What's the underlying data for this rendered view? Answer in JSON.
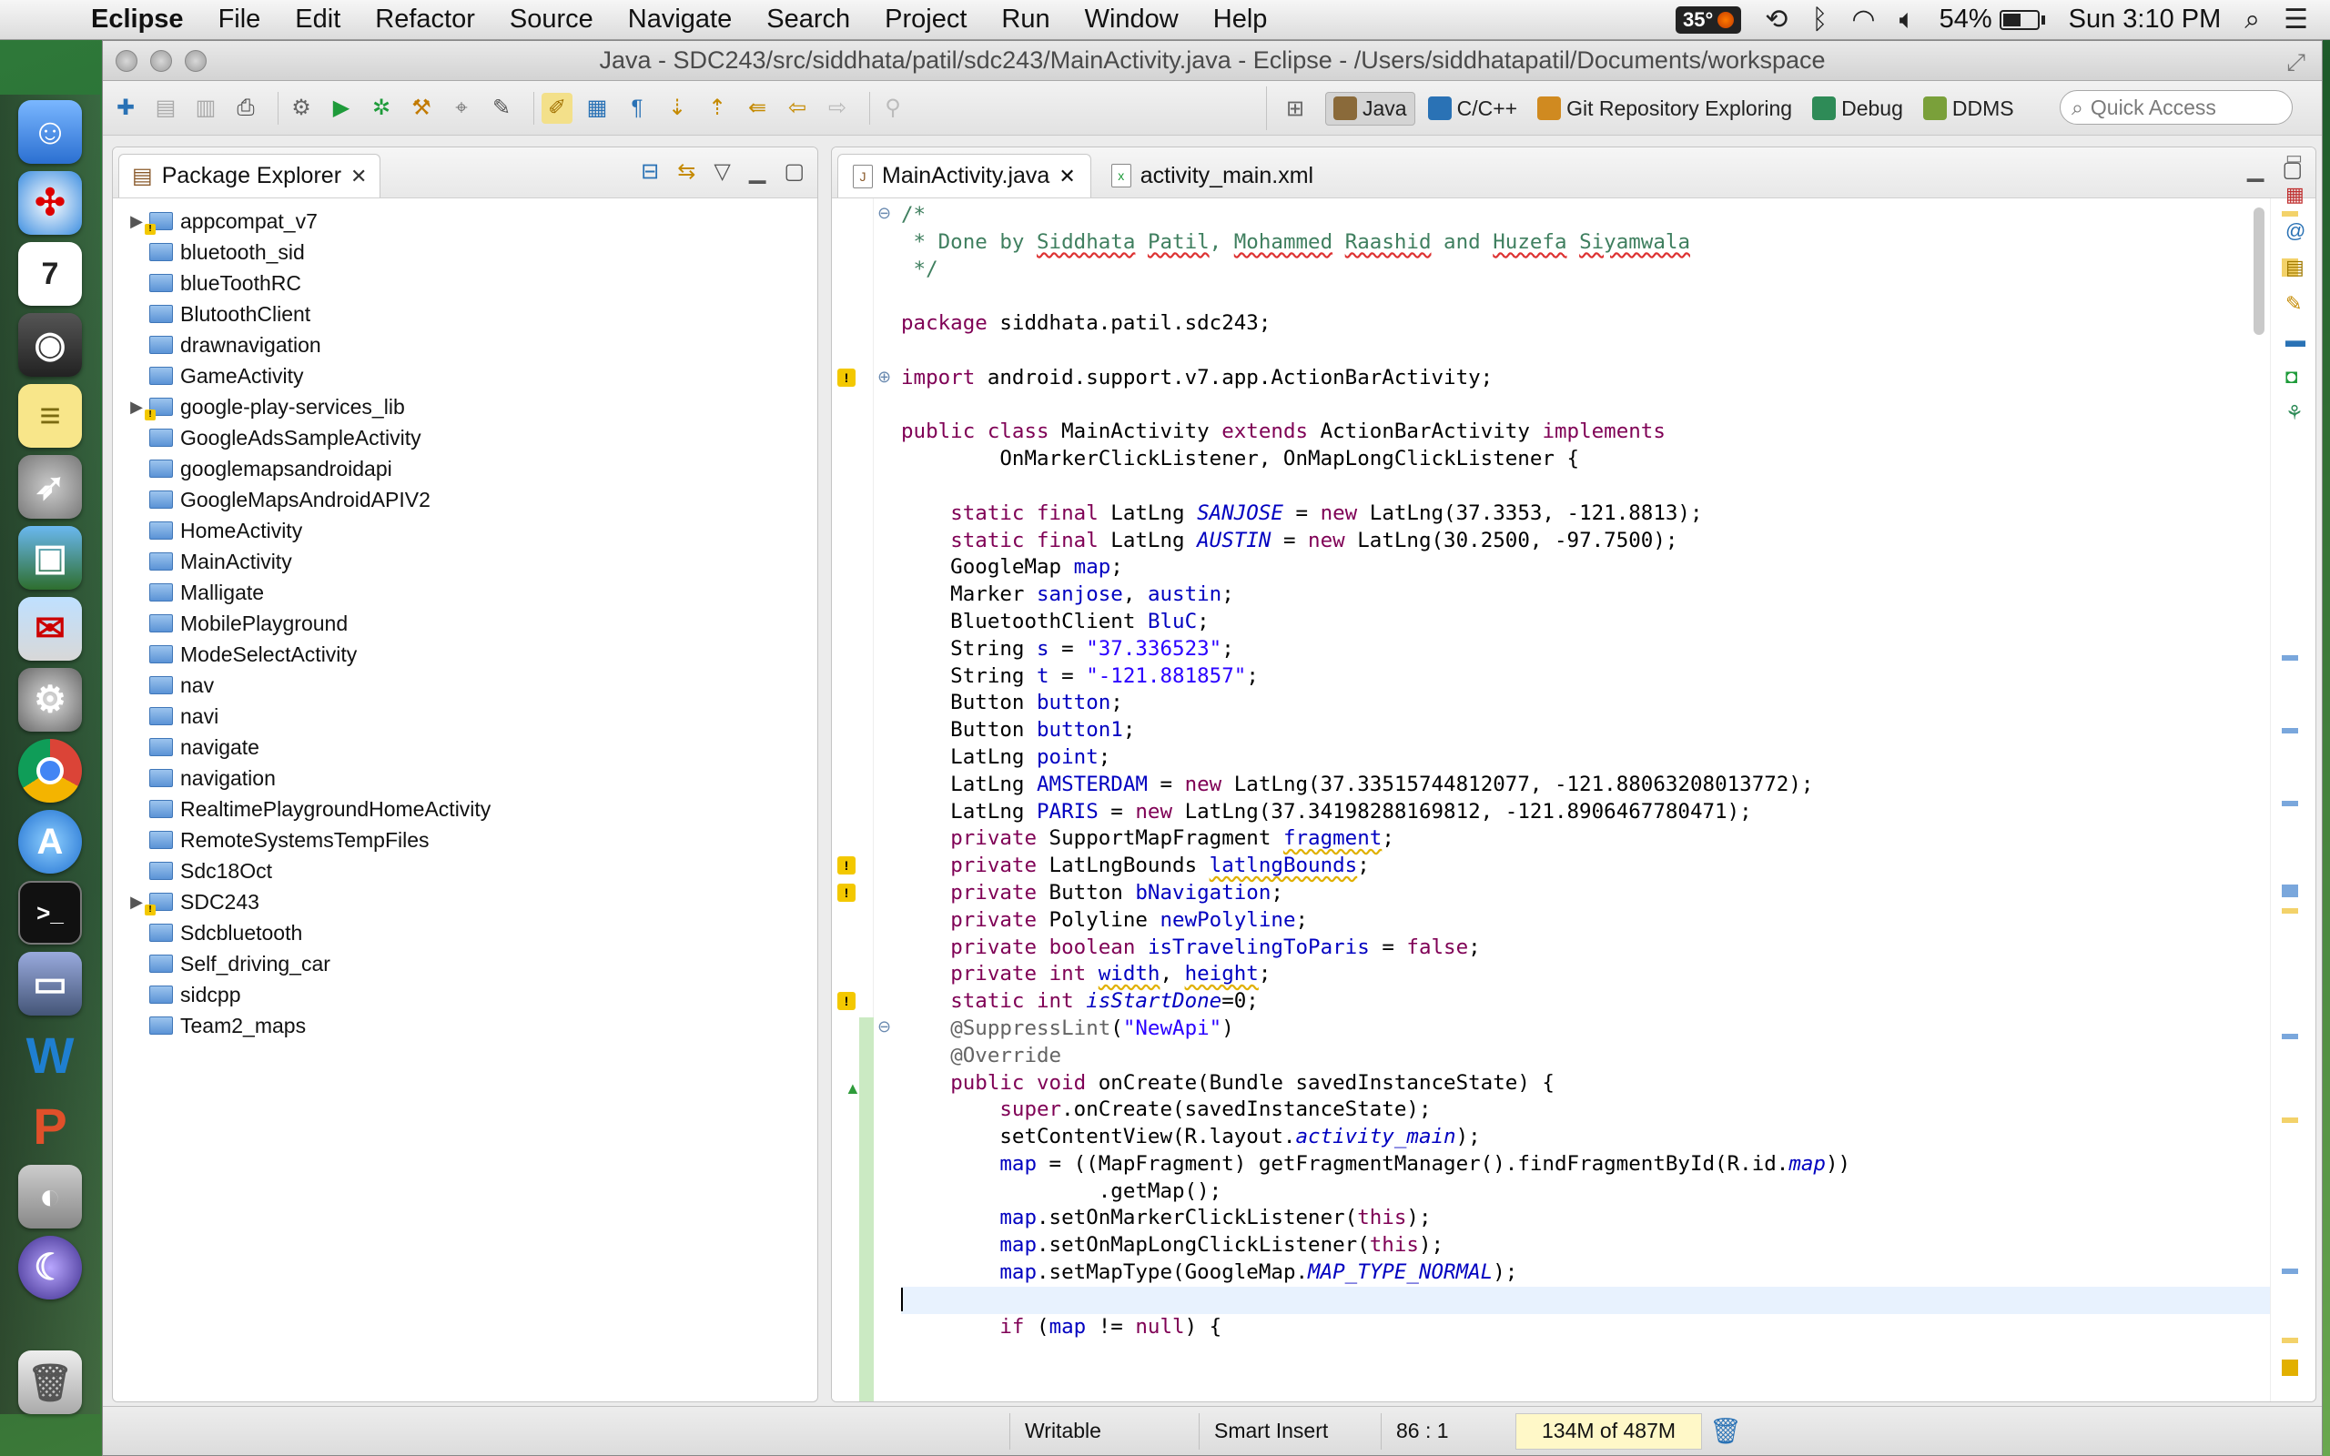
{
  "menubar": {
    "app_name": "Eclipse",
    "menus": [
      "File",
      "Edit",
      "Refactor",
      "Source",
      "Navigate",
      "Search",
      "Project",
      "Run",
      "Window",
      "Help"
    ],
    "temperature": "35°",
    "battery_percent": "54%",
    "battery_level": 0.54,
    "clock": "Sun 3:10 PM"
  },
  "window": {
    "title": "Java - SDC243/src/siddhata/patil/sdc243/MainActivity.java - Eclipse - /Users/siddhatapatil/Documents/workspace"
  },
  "perspectives": [
    {
      "label": "Java",
      "icon": "java-perspective-icon",
      "active": true
    },
    {
      "label": "C/C++",
      "icon": "cpp-perspective-icon",
      "active": false
    },
    {
      "label": "Git Repository Exploring",
      "icon": "git-perspective-icon",
      "active": false
    },
    {
      "label": "Debug",
      "icon": "debug-perspective-icon",
      "active": false
    },
    {
      "label": "DDMS",
      "icon": "ddms-perspective-icon",
      "active": false
    }
  ],
  "quick_access": {
    "placeholder": "Quick Access"
  },
  "package_explorer": {
    "title": "Package Explorer",
    "projects": [
      {
        "name": "appcompat_v7",
        "expandable": true,
        "warning": true
      },
      {
        "name": "bluetooth_sid",
        "expandable": false,
        "warning": false
      },
      {
        "name": "blueToothRC",
        "expandable": false,
        "warning": false
      },
      {
        "name": "BlutoothClient",
        "expandable": false,
        "warning": false
      },
      {
        "name": "drawnavigation",
        "expandable": false,
        "warning": false
      },
      {
        "name": "GameActivity",
        "expandable": false,
        "warning": false
      },
      {
        "name": "google-play-services_lib",
        "expandable": true,
        "warning": true
      },
      {
        "name": "GoogleAdsSampleActivity",
        "expandable": false,
        "warning": false
      },
      {
        "name": "googlemapsandroidapi",
        "expandable": false,
        "warning": false
      },
      {
        "name": "GoogleMapsAndroidAPIV2",
        "expandable": false,
        "warning": false
      },
      {
        "name": "HomeActivity",
        "expandable": false,
        "warning": false
      },
      {
        "name": "MainActivity",
        "expandable": false,
        "warning": false
      },
      {
        "name": "Malligate",
        "expandable": false,
        "warning": false
      },
      {
        "name": "MobilePlayground",
        "expandable": false,
        "warning": false
      },
      {
        "name": "ModeSelectActivity",
        "expandable": false,
        "warning": false
      },
      {
        "name": "nav",
        "expandable": false,
        "warning": false
      },
      {
        "name": "navi",
        "expandable": false,
        "warning": false
      },
      {
        "name": "navigate",
        "expandable": false,
        "warning": false
      },
      {
        "name": "navigation",
        "expandable": false,
        "warning": false
      },
      {
        "name": "RealtimePlaygroundHomeActivity",
        "expandable": false,
        "warning": false
      },
      {
        "name": "RemoteSystemsTempFiles",
        "expandable": false,
        "warning": false
      },
      {
        "name": "Sdc18Oct",
        "expandable": false,
        "warning": false
      },
      {
        "name": "SDC243",
        "expandable": true,
        "warning": true
      },
      {
        "name": "Sdcbluetooth",
        "expandable": false,
        "warning": false
      },
      {
        "name": "Self_driving_car",
        "expandable": false,
        "warning": false
      },
      {
        "name": "sidcpp",
        "expandable": false,
        "warning": false
      },
      {
        "name": "Team2_maps",
        "expandable": false,
        "warning": false
      }
    ]
  },
  "editor": {
    "tabs": [
      {
        "label": "MainActivity.java",
        "active": true,
        "icon": "java-file-icon"
      },
      {
        "label": "activity_main.xml",
        "active": false,
        "icon": "xml-file-icon"
      }
    ],
    "current_line": 40,
    "warning_lines": [
      6,
      24,
      25,
      29
    ],
    "code_lines": [
      [
        [
          "cm",
          "/*"
        ]
      ],
      [
        [
          "cm",
          " * Done by "
        ],
        [
          "cm spell",
          "Siddhata"
        ],
        [
          "cm",
          " "
        ],
        [
          "cm spell",
          "Patil"
        ],
        [
          "cm",
          ", "
        ],
        [
          "cm spell",
          "Mohammed"
        ],
        [
          "cm",
          " "
        ],
        [
          "cm spell",
          "Raashid"
        ],
        [
          "cm",
          " and "
        ],
        [
          "cm spell",
          "Huzefa"
        ],
        [
          "cm",
          " "
        ],
        [
          "cm spell",
          "Siyamwala"
        ]
      ],
      [
        [
          "cm",
          " */"
        ]
      ],
      [],
      [
        [
          "kw",
          "package"
        ],
        [
          "",
          " siddhata.patil.sdc243;"
        ]
      ],
      [],
      [
        [
          "kw",
          "import"
        ],
        [
          "",
          " android.support.v7.app.ActionBarActivity;"
        ]
      ],
      [],
      [
        [
          "kw",
          "public"
        ],
        [
          "",
          " "
        ],
        [
          "kw",
          "class"
        ],
        [
          "",
          " MainActivity "
        ],
        [
          "kw",
          "extends"
        ],
        [
          "",
          " ActionBarActivity "
        ],
        [
          "kw",
          "implements"
        ]
      ],
      [
        [
          "",
          "        OnMarkerClickListener, OnMapLongClickListener {"
        ]
      ],
      [],
      [
        [
          "",
          "    "
        ],
        [
          "kw",
          "static"
        ],
        [
          "",
          " "
        ],
        [
          "kw",
          "final"
        ],
        [
          "",
          " LatLng "
        ],
        [
          "sfld",
          "SANJOSE"
        ],
        [
          "",
          " = "
        ],
        [
          "kw",
          "new"
        ],
        [
          "",
          " LatLng(37.3353, -121.8813);"
        ]
      ],
      [
        [
          "",
          "    "
        ],
        [
          "kw",
          "static"
        ],
        [
          "",
          " "
        ],
        [
          "kw",
          "final"
        ],
        [
          "",
          " LatLng "
        ],
        [
          "sfld",
          "AUSTIN"
        ],
        [
          "",
          " = "
        ],
        [
          "kw",
          "new"
        ],
        [
          "",
          " LatLng(30.2500, -97.7500);"
        ]
      ],
      [
        [
          "",
          "    GoogleMap "
        ],
        [
          "fld",
          "map"
        ],
        [
          "",
          ";"
        ]
      ],
      [
        [
          "",
          "    Marker "
        ],
        [
          "fld",
          "sanjose"
        ],
        [
          "",
          ", "
        ],
        [
          "fld",
          "austin"
        ],
        [
          "",
          ";"
        ]
      ],
      [
        [
          "",
          "    BluetoothClient "
        ],
        [
          "fld",
          "BluC"
        ],
        [
          "",
          ";"
        ]
      ],
      [
        [
          "",
          "    String "
        ],
        [
          "fld",
          "s"
        ],
        [
          "",
          " = "
        ],
        [
          "str",
          "\"37.336523\""
        ],
        [
          "",
          ";"
        ]
      ],
      [
        [
          "",
          "    String "
        ],
        [
          "fld",
          "t"
        ],
        [
          "",
          " = "
        ],
        [
          "str",
          "\"-121.881857\""
        ],
        [
          "",
          ";"
        ]
      ],
      [
        [
          "",
          "    Button "
        ],
        [
          "fld",
          "button"
        ],
        [
          "",
          ";"
        ]
      ],
      [
        [
          "",
          "    Button "
        ],
        [
          "fld",
          "button1"
        ],
        [
          "",
          ";"
        ]
      ],
      [
        [
          "",
          "    LatLng "
        ],
        [
          "fld",
          "point"
        ],
        [
          "",
          ";"
        ]
      ],
      [
        [
          "",
          "    LatLng "
        ],
        [
          "fld",
          "AMSTERDAM"
        ],
        [
          "",
          " = "
        ],
        [
          "kw",
          "new"
        ],
        [
          "",
          " LatLng(37.33515744812077, -121.88063208013772);"
        ]
      ],
      [
        [
          "",
          "    LatLng "
        ],
        [
          "fld",
          "PARIS"
        ],
        [
          "",
          " = "
        ],
        [
          "kw",
          "new"
        ],
        [
          "",
          " LatLng(37.34198288169812, -121.8906467780471);"
        ]
      ],
      [
        [
          "",
          "    "
        ],
        [
          "kw",
          "private"
        ],
        [
          "",
          " SupportMapFragment "
        ],
        [
          "fld warnul",
          "fragment"
        ],
        [
          "",
          ";"
        ]
      ],
      [
        [
          "",
          "    "
        ],
        [
          "kw",
          "private"
        ],
        [
          "",
          " LatLngBounds "
        ],
        [
          "fld warnul",
          "latlngBounds"
        ],
        [
          "",
          ";"
        ]
      ],
      [
        [
          "",
          "    "
        ],
        [
          "kw",
          "private"
        ],
        [
          "",
          " Button "
        ],
        [
          "fld",
          "bNavigation"
        ],
        [
          "",
          ";"
        ]
      ],
      [
        [
          "",
          "    "
        ],
        [
          "kw",
          "private"
        ],
        [
          "",
          " Polyline "
        ],
        [
          "fld",
          "newPolyline"
        ],
        [
          "",
          ";"
        ]
      ],
      [
        [
          "",
          "    "
        ],
        [
          "kw",
          "private"
        ],
        [
          "",
          " "
        ],
        [
          "kw",
          "boolean"
        ],
        [
          "",
          " "
        ],
        [
          "fld",
          "isTravelingToParis"
        ],
        [
          "",
          " = "
        ],
        [
          "kw",
          "false"
        ],
        [
          "",
          ";"
        ]
      ],
      [
        [
          "",
          "    "
        ],
        [
          "kw",
          "private"
        ],
        [
          "",
          " "
        ],
        [
          "kw",
          "int"
        ],
        [
          "",
          " "
        ],
        [
          "fld warnul",
          "width"
        ],
        [
          "",
          ", "
        ],
        [
          "fld warnul",
          "height"
        ],
        [
          "",
          ";"
        ]
      ],
      [
        [
          "",
          "    "
        ],
        [
          "kw",
          "static"
        ],
        [
          "",
          " "
        ],
        [
          "kw",
          "int"
        ],
        [
          "",
          " "
        ],
        [
          "sfld",
          "isStartDone"
        ],
        [
          "",
          "=0;"
        ]
      ],
      [
        [
          "",
          "    "
        ],
        [
          "ann",
          "@SuppressLint"
        ],
        [
          "",
          "("
        ],
        [
          "str",
          "\"NewApi\""
        ],
        [
          "",
          ")"
        ]
      ],
      [
        [
          "",
          "    "
        ],
        [
          "ann",
          "@Override"
        ]
      ],
      [
        [
          "",
          "    "
        ],
        [
          "kw",
          "public"
        ],
        [
          "",
          " "
        ],
        [
          "kw",
          "void"
        ],
        [
          "",
          " onCreate(Bundle savedInstanceState) {"
        ]
      ],
      [
        [
          "",
          "        "
        ],
        [
          "kw",
          "super"
        ],
        [
          "",
          ".onCreate(savedInstanceState);"
        ]
      ],
      [
        [
          "",
          "        setContentView(R.layout."
        ],
        [
          "sfld",
          "activity_main"
        ],
        [
          "",
          ");"
        ]
      ],
      [
        [
          "",
          "        "
        ],
        [
          "fld",
          "map"
        ],
        [
          "",
          " = ((MapFragment) getFragmentManager().findFragmentById(R.id."
        ],
        [
          "sfld",
          "map"
        ],
        [
          "",
          "))"
        ]
      ],
      [
        [
          "",
          "                .getMap();"
        ]
      ],
      [
        [
          "",
          "        "
        ],
        [
          "fld",
          "map"
        ],
        [
          "",
          ".setOnMarkerClickListener("
        ],
        [
          "kw",
          "this"
        ],
        [
          "",
          ");"
        ]
      ],
      [
        [
          "",
          "        "
        ],
        [
          "fld",
          "map"
        ],
        [
          "",
          ".setOnMapLongClickListener("
        ],
        [
          "kw",
          "this"
        ],
        [
          "",
          ");"
        ]
      ],
      [
        [
          "",
          "        "
        ],
        [
          "fld",
          "map"
        ],
        [
          "",
          ".setMapType(GoogleMap."
        ],
        [
          "sfld",
          "MAP_TYPE_NORMAL"
        ],
        [
          "",
          ");"
        ]
      ],
      [],
      [
        [
          "",
          "        "
        ],
        [
          "kw",
          "if"
        ],
        [
          "",
          " ("
        ],
        [
          "fld",
          "map"
        ],
        [
          "",
          " != "
        ],
        [
          "kw",
          "null"
        ],
        [
          "",
          ") {"
        ]
      ]
    ]
  },
  "statusbar": {
    "writable": "Writable",
    "insert_mode": "Smart Insert",
    "cursor_position": "86 : 1",
    "heap": "134M of 487M"
  }
}
